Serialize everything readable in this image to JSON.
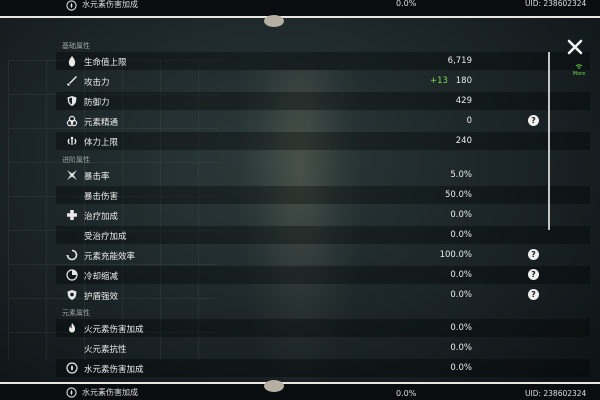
{
  "header": {
    "partial_label": "水元素伤害加成",
    "partial_value": "0.0%",
    "uid": "UID: 238602324"
  },
  "footer": {
    "label": "水元素伤害加成",
    "value": "0.0%",
    "uid": "UID: 238602324"
  },
  "close_label": "close",
  "more": {
    "label": "More"
  },
  "sections": {
    "basic": "基础属性",
    "advanced": "进阶属性",
    "element": "元素属性"
  },
  "stats": {
    "hp": {
      "label": "生命值上限",
      "value": "6,719",
      "icon": "hp-drop-icon"
    },
    "atk": {
      "label": "攻击力",
      "value": "180",
      "bonus": "+13",
      "icon": "sword-icon"
    },
    "def": {
      "label": "防御力",
      "value": "429",
      "icon": "shield-icon"
    },
    "em": {
      "label": "元素精通",
      "value": "0",
      "icon": "elemental-mastery-icon",
      "help": "?"
    },
    "stamina": {
      "label": "体力上限",
      "value": "240",
      "icon": "stamina-icon"
    },
    "crit_rate": {
      "label": "暴击率",
      "value": "5.0%",
      "icon": "crit-icon"
    },
    "crit_dmg": {
      "label": "暴击伤害",
      "value": "50.0%"
    },
    "heal_bonus": {
      "label": "治疗加成",
      "value": "0.0%",
      "icon": "cross-icon"
    },
    "incoming_heal": {
      "label": "受治疗加成",
      "value": "0.0%"
    },
    "energy_recharge": {
      "label": "元素充能效率",
      "value": "100.0%",
      "icon": "recharge-icon",
      "help": "?"
    },
    "cd_reduction": {
      "label": "冷却缩减",
      "value": "0.0%",
      "icon": "cooldown-icon",
      "help": "?"
    },
    "shield_strength": {
      "label": "护盾强效",
      "value": "0.0%",
      "icon": "shield-strength-icon",
      "help": "?"
    },
    "pyro_dmg": {
      "label": "火元素伤害加成",
      "value": "0.0%",
      "icon": "pyro-icon"
    },
    "pyro_res": {
      "label": "火元素抗性",
      "value": "0.0%"
    },
    "hydro_dmg": {
      "label": "水元素伤害加成",
      "value": "0.0%",
      "icon": "hydro-icon"
    }
  },
  "colors": {
    "bonus_green": "#7fdc4b",
    "accent": "#71d44e",
    "frame": "#e9e6df"
  }
}
